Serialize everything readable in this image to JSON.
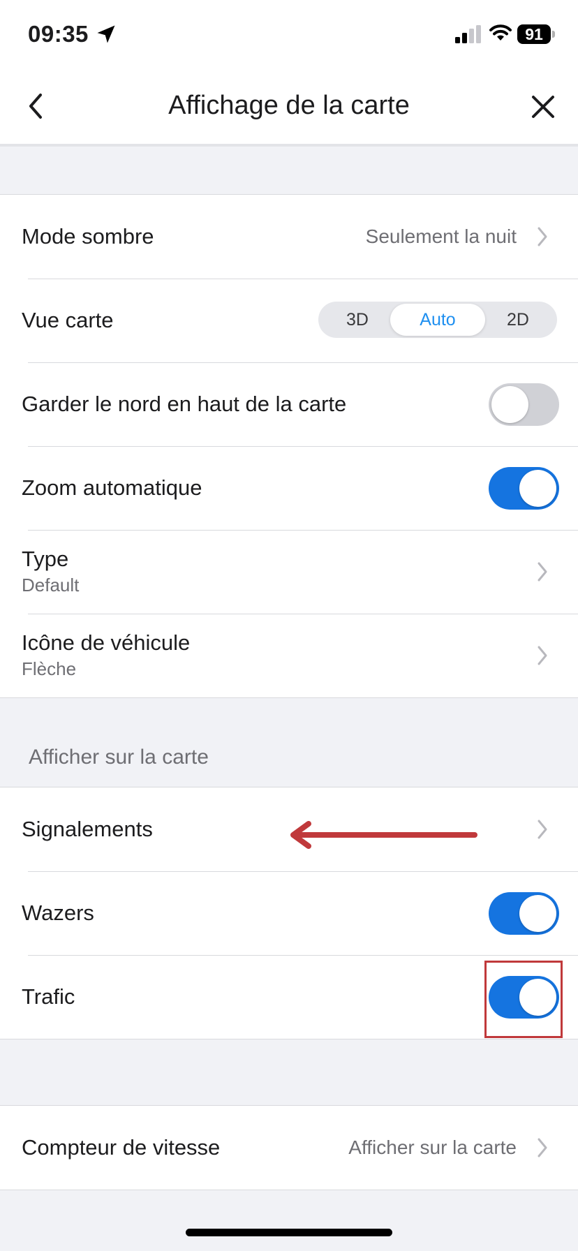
{
  "status": {
    "time": "09:35",
    "battery": "91",
    "icons": [
      "location-arrow-icon",
      "cellular-signal-icon",
      "wifi-icon",
      "battery-icon"
    ]
  },
  "nav": {
    "title": "Affichage de la carte",
    "back_icon": "chevron-left-icon",
    "close_icon": "close-icon"
  },
  "settings": {
    "dark_mode": {
      "label": "Mode sombre",
      "value": "Seulement la nuit"
    },
    "map_view": {
      "label": "Vue carte",
      "options": [
        "3D",
        "Auto",
        "2D"
      ],
      "selected": "Auto"
    },
    "north_up": {
      "label": "Garder le nord en haut de la carte",
      "on": false
    },
    "auto_zoom": {
      "label": "Zoom automatique",
      "on": true
    },
    "type": {
      "label": "Type",
      "value": "Default"
    },
    "vehicle_icon": {
      "label": "Icône de véhicule",
      "value": "Flèche"
    }
  },
  "show_on_map": {
    "header": "Afficher sur la carte",
    "reports": {
      "label": "Signalements"
    },
    "wazers": {
      "label": "Wazers",
      "on": true
    },
    "traffic": {
      "label": "Trafic",
      "on": true
    }
  },
  "speedometer": {
    "label": "Compteur de vitesse",
    "value": "Afficher sur la carte"
  },
  "colors": {
    "toggle_on": "#1574e0",
    "toggle_off": "#d0d1d6",
    "segment_selected": "#1e8ff0",
    "annotation": "#c0393b",
    "background": "#f1f2f6"
  }
}
